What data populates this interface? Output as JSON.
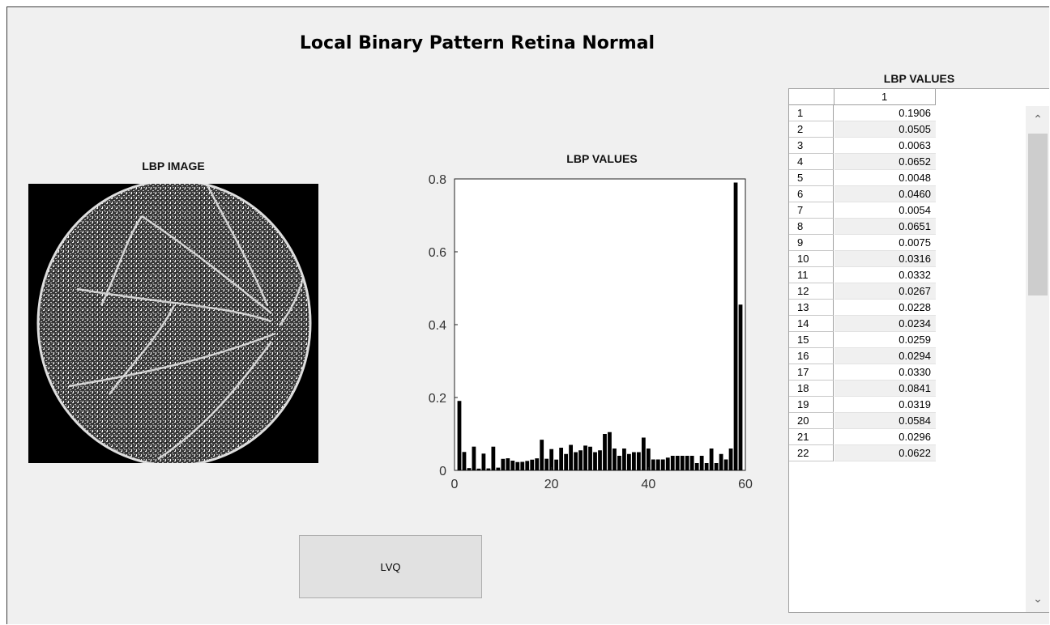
{
  "window": {
    "title": "Local Binary Pattern Retina Normal"
  },
  "image_panel": {
    "title": "LBP IMAGE"
  },
  "chart_data": {
    "type": "bar",
    "title": "LBP VALUES",
    "xlim": [
      0,
      60
    ],
    "ylim": [
      0,
      0.8
    ],
    "xticks": [
      "0",
      "20",
      "40",
      "60"
    ],
    "yticks": [
      "0",
      "0.2",
      "0.4",
      "0.6",
      "0.8"
    ],
    "x": [
      1,
      2,
      3,
      4,
      5,
      6,
      7,
      8,
      9,
      10,
      11,
      12,
      13,
      14,
      15,
      16,
      17,
      18,
      19,
      20,
      21,
      22,
      23,
      24,
      25,
      26,
      27,
      28,
      29,
      30,
      31,
      32,
      33,
      34,
      35,
      36,
      37,
      38,
      39,
      40,
      41,
      42,
      43,
      44,
      45,
      46,
      47,
      48,
      49,
      50,
      51,
      52,
      53,
      54,
      55,
      56,
      57,
      58,
      59
    ],
    "values": [
      0.1906,
      0.0505,
      0.0063,
      0.0652,
      0.0048,
      0.046,
      0.0054,
      0.0651,
      0.0075,
      0.0316,
      0.0332,
      0.0267,
      0.0228,
      0.0234,
      0.0259,
      0.0294,
      0.033,
      0.0841,
      0.0319,
      0.0584,
      0.0296,
      0.0622,
      0.045,
      0.07,
      0.05,
      0.055,
      0.068,
      0.065,
      0.05,
      0.055,
      0.1,
      0.105,
      0.06,
      0.04,
      0.06,
      0.045,
      0.05,
      0.05,
      0.09,
      0.06,
      0.03,
      0.03,
      0.03,
      0.035,
      0.04,
      0.04,
      0.04,
      0.04,
      0.04,
      0.02,
      0.04,
      0.02,
      0.06,
      0.02,
      0.045,
      0.03,
      0.06,
      0.79,
      0.455
    ],
    "grid": false
  },
  "table": {
    "title": "LBP VALUES",
    "column_header": "1",
    "rows": [
      {
        "label": "1",
        "value": "0.1906"
      },
      {
        "label": "2",
        "value": "0.0505"
      },
      {
        "label": "3",
        "value": "0.0063"
      },
      {
        "label": "4",
        "value": "0.0652"
      },
      {
        "label": "5",
        "value": "0.0048"
      },
      {
        "label": "6",
        "value": "0.0460"
      },
      {
        "label": "7",
        "value": "0.0054"
      },
      {
        "label": "8",
        "value": "0.0651"
      },
      {
        "label": "9",
        "value": "0.0075"
      },
      {
        "label": "10",
        "value": "0.0316"
      },
      {
        "label": "11",
        "value": "0.0332"
      },
      {
        "label": "12",
        "value": "0.0267"
      },
      {
        "label": "13",
        "value": "0.0228"
      },
      {
        "label": "14",
        "value": "0.0234"
      },
      {
        "label": "15",
        "value": "0.0259"
      },
      {
        "label": "16",
        "value": "0.0294"
      },
      {
        "label": "17",
        "value": "0.0330"
      },
      {
        "label": "18",
        "value": "0.0841"
      },
      {
        "label": "19",
        "value": "0.0319"
      },
      {
        "label": "20",
        "value": "0.0584"
      },
      {
        "label": "21",
        "value": "0.0296"
      },
      {
        "label": "22",
        "value": "0.0622"
      }
    ]
  },
  "buttons": {
    "lvq": "LVQ"
  },
  "icons": {
    "scroll_up": "chevron-up-icon",
    "scroll_down": "chevron-down-icon"
  }
}
